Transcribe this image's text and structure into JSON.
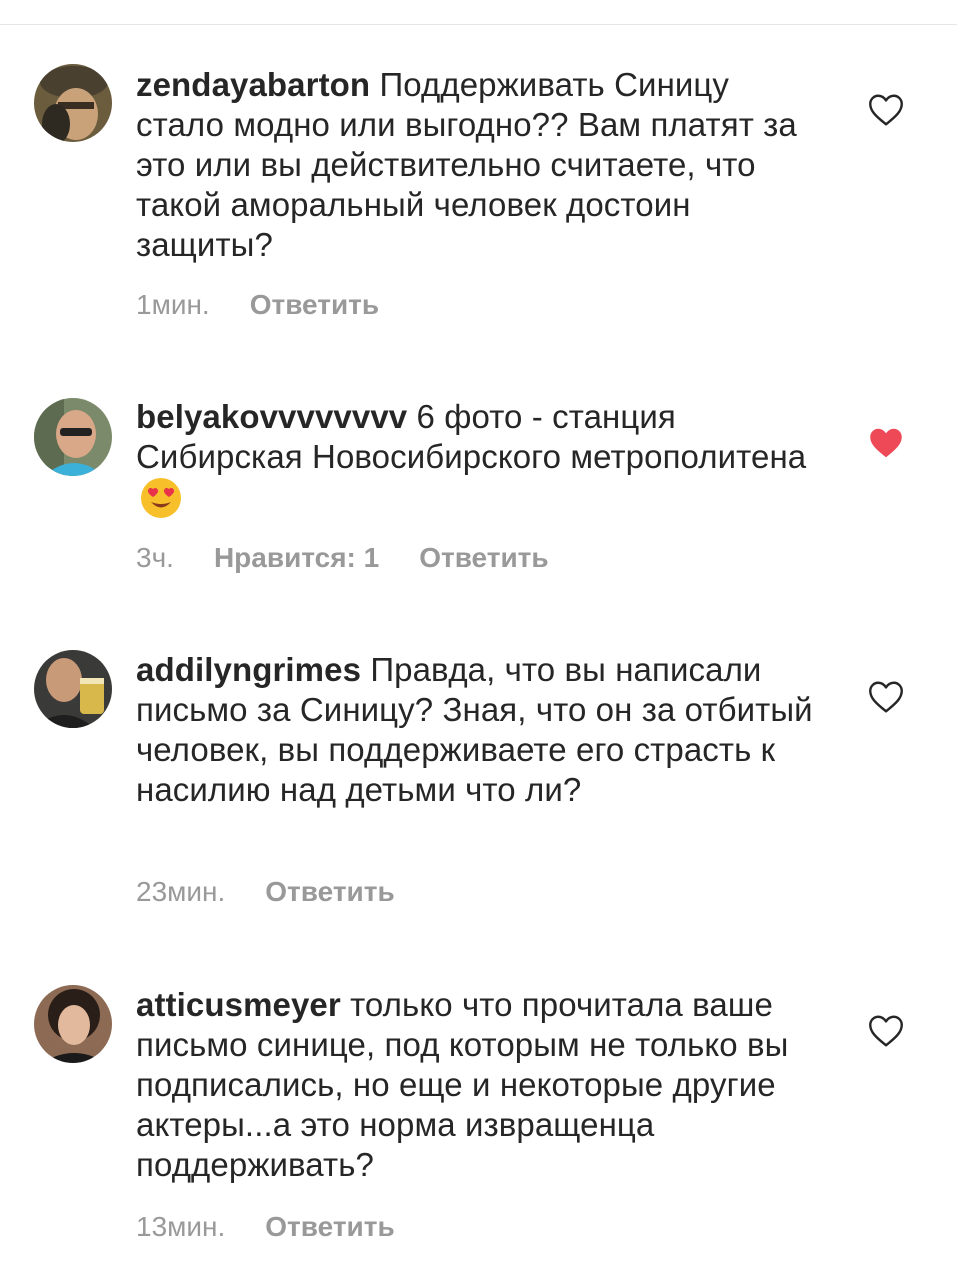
{
  "comments": [
    {
      "username": "zendayabarton",
      "text": "Поддерживать Синицу стало модно или выгодно?? Вам платят за это или вы действительно считаете, что такой аморальный человек достоин защиты?",
      "time": "1мин.",
      "likes": "",
      "reply": "Ответить",
      "liked": false
    },
    {
      "username": "belyakovvvvvvvv",
      "text": "6 фото - станция Сибирская Новосибирского метрополитена",
      "emoji": "heart-eyes-emoji",
      "time": "3ч.",
      "likes": "Нравится: 1",
      "reply": "Ответить",
      "liked": true
    },
    {
      "username": "addilyngrimes",
      "text": "Правда, что вы написали письмо за Синицу? Зная, что он за отбитый человек, вы поддерживаете его страсть к насилию над детьми что ли?",
      "time": "23мин.",
      "likes": "",
      "reply": "Ответить",
      "liked": false
    },
    {
      "username": "atticusmeyer",
      "text": "только что прочитала ваше письмо синице, под которым не только вы подписались, но еще и некоторые другие актеры...а это норма извращенца поддерживать?",
      "time": "13мин.",
      "likes": "",
      "reply": "Ответить",
      "liked": false
    }
  ],
  "colors": {
    "text": "#262626",
    "meta": "#999999",
    "heart_liked": "#ed4956",
    "heart_outline": "#262626",
    "divider": "#e6e6e6"
  },
  "icons": {
    "heart_outline": "heart-outline-icon",
    "heart_filled": "heart-filled-icon"
  }
}
